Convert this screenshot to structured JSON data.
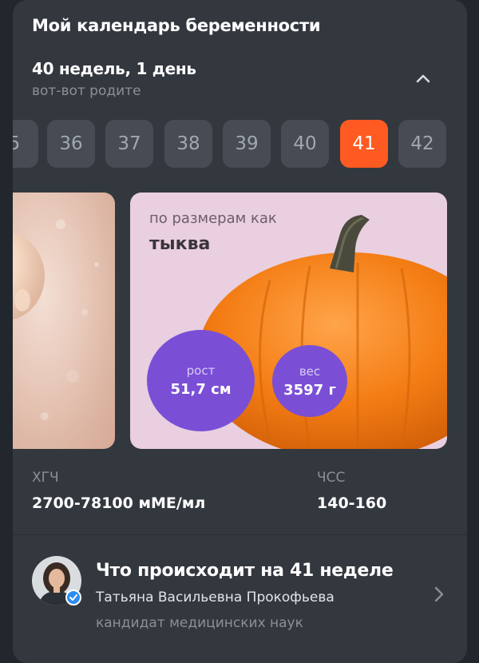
{
  "calendar": {
    "title": "Мой календарь беременности",
    "weeks_label": "40 недель, 1 день",
    "weeks_subtitle": "вот-вот родите",
    "collapse_icon": "chevron-up-icon"
  },
  "weeks": [
    {
      "label": "5",
      "active": false
    },
    {
      "label": "36",
      "active": false
    },
    {
      "label": "37",
      "active": false
    },
    {
      "label": "38",
      "active": false
    },
    {
      "label": "39",
      "active": false
    },
    {
      "label": "40",
      "active": false
    },
    {
      "label": "41",
      "active": true
    },
    {
      "label": "42",
      "active": false
    }
  ],
  "size_card": {
    "prefix": "по размерам как",
    "fruit": "тыква",
    "height_label": "рост",
    "height_value": "51,7 см",
    "weight_label": "вес",
    "weight_value": "3597 г"
  },
  "stats": {
    "hcg_label": "ХГЧ",
    "hcg_value": "2700-78100 мМЕ/мл",
    "hr_label": "ЧСС",
    "hr_value": "140-160"
  },
  "article": {
    "title": "Что происходит на 41 неделе",
    "author": "Татьяна Васильевна Прокофьева",
    "degree": "кандидат медицинских наук",
    "verified_icon": "verified-check-icon",
    "chevron_icon": "chevron-right-icon"
  },
  "colors": {
    "background": "#22272e",
    "card": "#33383f",
    "chip": "#474c54",
    "accent": "#ff5a21",
    "bubble": "#7a4fd6",
    "size_card_bg": "#e9cfe0"
  }
}
